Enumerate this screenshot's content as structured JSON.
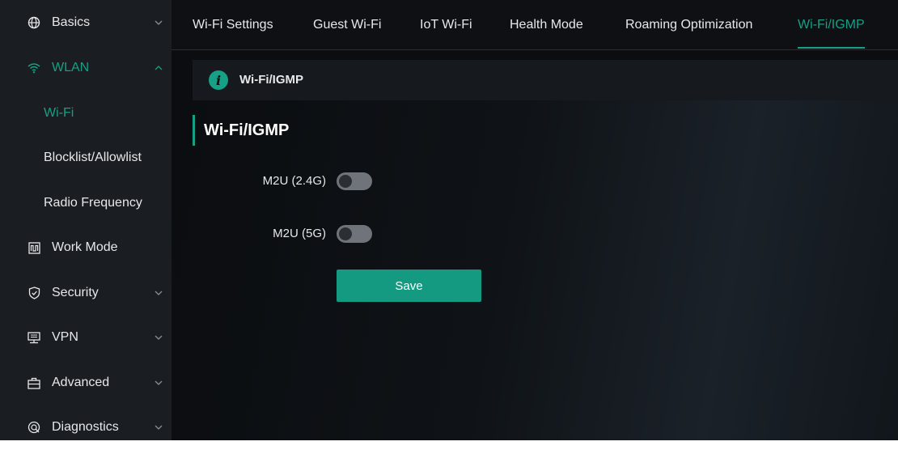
{
  "colors": {
    "accent": "#16a085",
    "sidebar_bg": "#1a1d21",
    "page_bg": "#0b0d10"
  },
  "sidebar": {
    "items": [
      {
        "label": "Basics",
        "icon": "globe-icon",
        "expandable": true
      },
      {
        "label": "WLAN",
        "icon": "wifi-icon",
        "expandable": true,
        "expanded": true
      },
      {
        "label": "Wi-Fi",
        "sub": true,
        "current": true
      },
      {
        "label": "Blocklist/Allowlist",
        "sub": true
      },
      {
        "label": "Radio Frequency",
        "sub": true
      },
      {
        "label": "Work Mode",
        "icon": "work-mode-icon",
        "expandable": false
      },
      {
        "label": "Security",
        "icon": "shield-check-icon",
        "expandable": true
      },
      {
        "label": "VPN",
        "icon": "vpn-icon",
        "expandable": true
      },
      {
        "label": "Advanced",
        "icon": "advanced-icon",
        "expandable": true
      },
      {
        "label": "Diagnostics",
        "icon": "diagnostics-icon",
        "expandable": true
      }
    ]
  },
  "tabs": [
    {
      "label": "Wi-Fi Settings"
    },
    {
      "label": "Guest Wi-Fi"
    },
    {
      "label": "IoT Wi-Fi"
    },
    {
      "label": "Health Mode"
    },
    {
      "label": "Roaming Optimization"
    },
    {
      "label": "Wi-Fi/IGMP",
      "active": true
    }
  ],
  "info": {
    "icon": "info-icon",
    "text": "Wi-Fi/IGMP"
  },
  "section": {
    "title": "Wi-Fi/IGMP"
  },
  "form": {
    "fields": [
      {
        "label": "M2U (2.4G)",
        "enabled": false
      },
      {
        "label": "M2U (5G)",
        "enabled": false
      }
    ],
    "save_label": "Save"
  }
}
